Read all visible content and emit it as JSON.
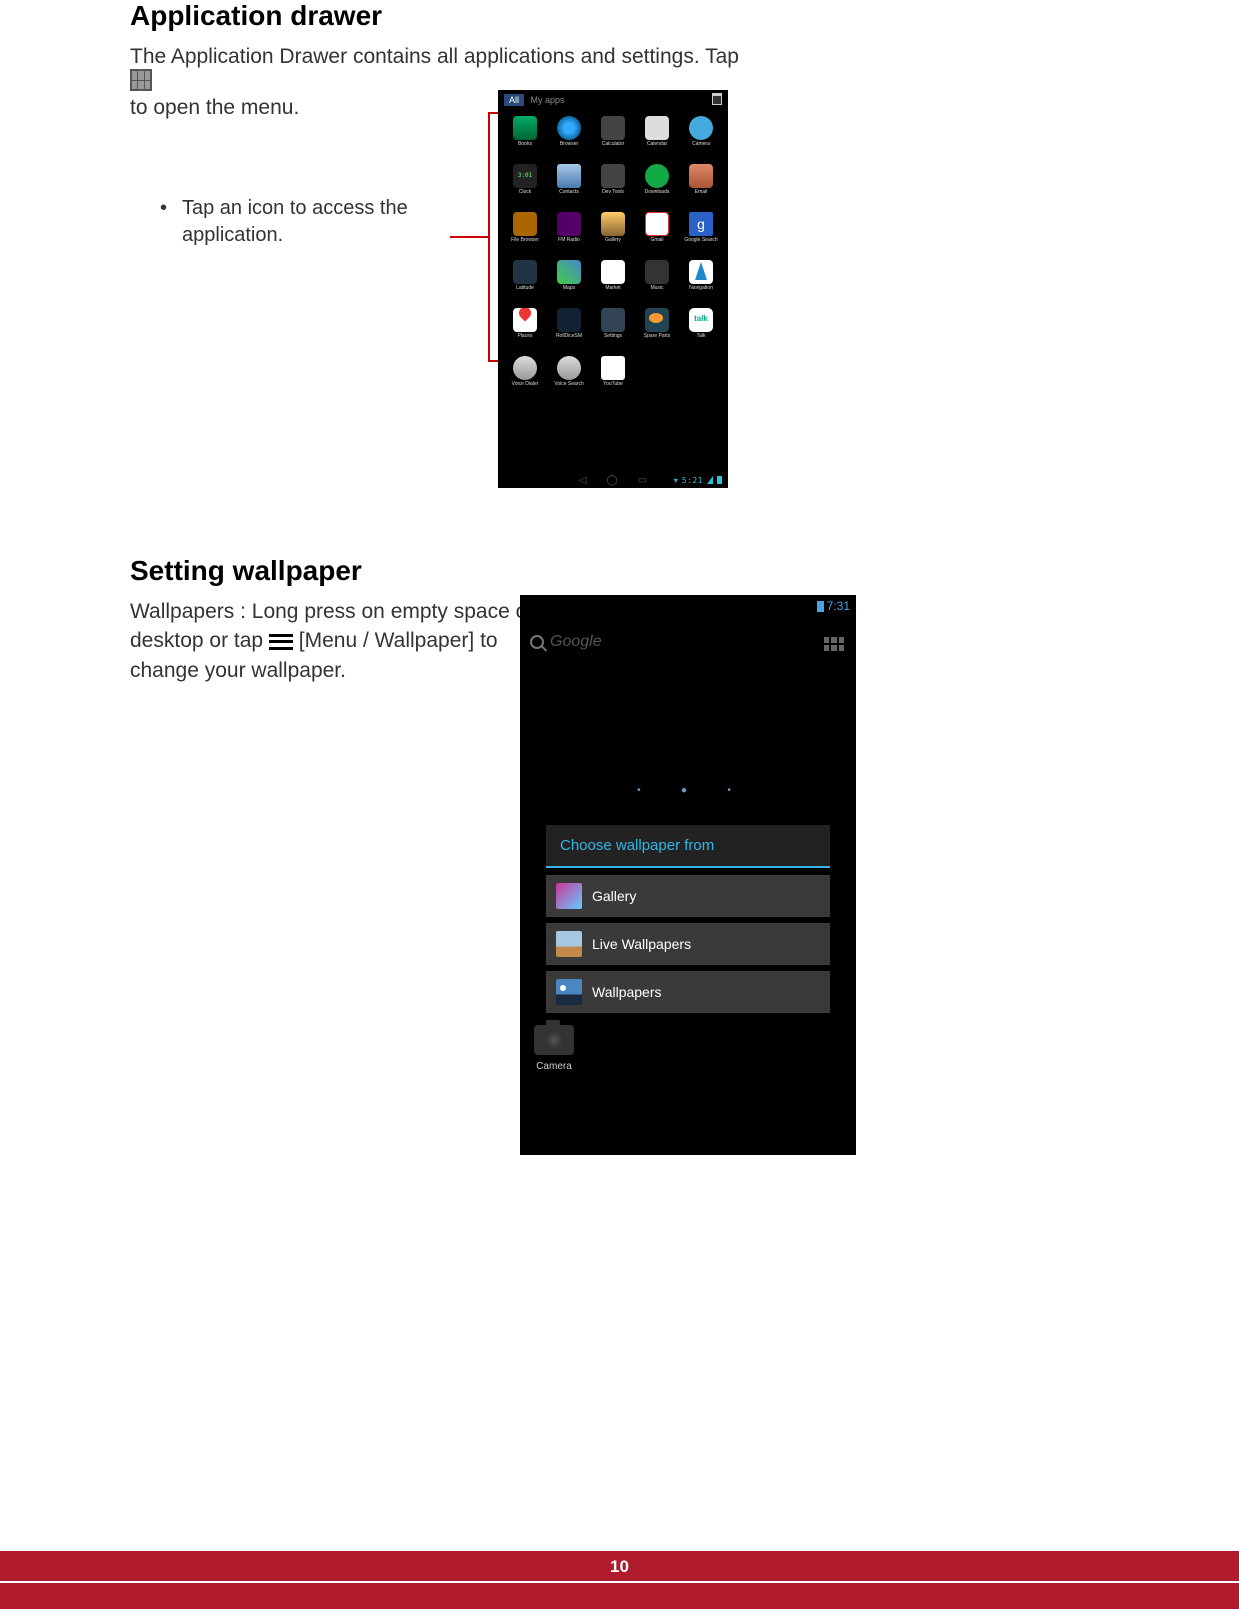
{
  "section1": {
    "heading": "Application drawer",
    "intro_1": "The Application Drawer contains all applications and settings. Tap ",
    "intro_2": " to open the menu.",
    "callout": "Tap an icon to access the application."
  },
  "drawer": {
    "tab_all": "All",
    "tab_my": "My apps",
    "clock": "5:21",
    "apps": [
      {
        "label": "Books",
        "cls": "ic-book"
      },
      {
        "label": "Browser",
        "cls": "ic-globe"
      },
      {
        "label": "Calculator",
        "cls": "ic-calc"
      },
      {
        "label": "Calendar",
        "cls": "ic-cal"
      },
      {
        "label": "Camera",
        "cls": "ic-cam"
      },
      {
        "label": "Clock",
        "cls": "ic-clock",
        "txt": "3:01"
      },
      {
        "label": "Contacts",
        "cls": "ic-contacts"
      },
      {
        "label": "Dev Tools",
        "cls": "ic-dev"
      },
      {
        "label": "Downloads",
        "cls": "ic-dl"
      },
      {
        "label": "Email",
        "cls": "ic-email"
      },
      {
        "label": "File Browser",
        "cls": "ic-fb"
      },
      {
        "label": "FM Radio",
        "cls": "ic-fm"
      },
      {
        "label": "Gallery",
        "cls": "ic-gal"
      },
      {
        "label": "Gmail",
        "cls": "ic-gmail"
      },
      {
        "label": "Google Search",
        "cls": "ic-gs",
        "txt": "g"
      },
      {
        "label": "Latitude",
        "cls": "ic-lat"
      },
      {
        "label": "Maps",
        "cls": "ic-maps"
      },
      {
        "label": "Market",
        "cls": "ic-market"
      },
      {
        "label": "Music",
        "cls": "ic-music"
      },
      {
        "label": "Navigation",
        "cls": "ic-nav"
      },
      {
        "label": "Places",
        "cls": "ic-places"
      },
      {
        "label": "RollDiceSM",
        "cls": "ic-roll"
      },
      {
        "label": "Settings",
        "cls": "ic-set"
      },
      {
        "label": "Spare Parts",
        "cls": "ic-spare"
      },
      {
        "label": "Talk",
        "cls": "ic-talk",
        "txt": "talk"
      },
      {
        "label": "Voice Dialer",
        "cls": "ic-vd"
      },
      {
        "label": "Voice Search",
        "cls": "ic-vs"
      },
      {
        "label": "YouTube",
        "cls": "ic-yt"
      }
    ]
  },
  "section2": {
    "heading": "Setting wallpaper",
    "para_a": "Wallpapers : Long press on empty space on desktop or tap ",
    "para_b": " [Menu / Wallpaper] to change your wallpaper."
  },
  "phone2": {
    "time": "7:31",
    "search": "Google",
    "sheet_title": "Choose wallpaper from",
    "items": [
      {
        "label": "Gallery",
        "cls": "gal"
      },
      {
        "label": "Live Wallpapers",
        "cls": "live"
      },
      {
        "label": "Wallpapers",
        "cls": "wall"
      }
    ],
    "camera": "Camera"
  },
  "page_number": "10"
}
